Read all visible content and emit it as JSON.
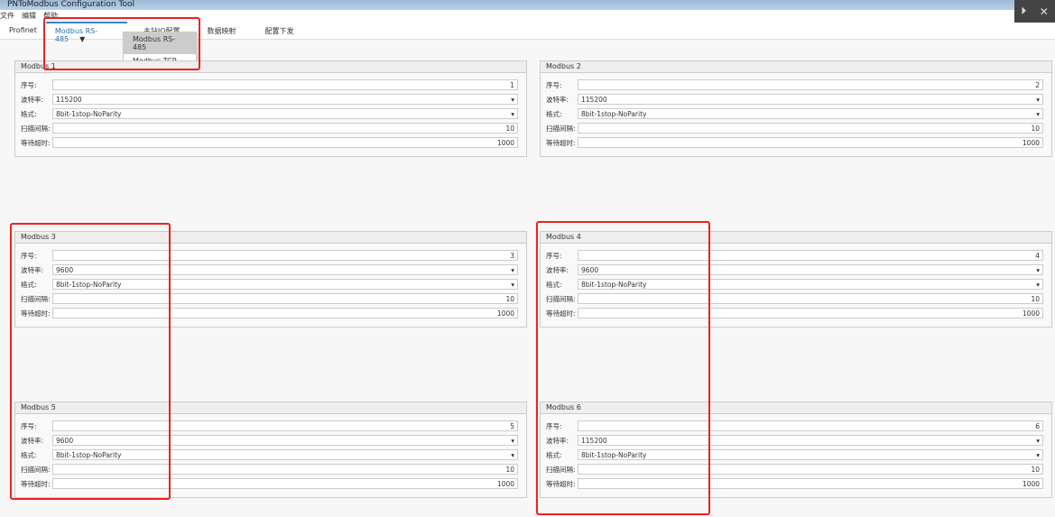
{
  "window": {
    "title": "PNToModbus Configuration Tool"
  },
  "menu": [
    "文件",
    "编辑",
    "帮助"
  ],
  "tabs": [
    "Profinet",
    "Modbus RS-485",
    "主站IO配置",
    "数据映射",
    "配置下发"
  ],
  "tab_dropdown": {
    "arrow": "▼",
    "options": [
      "Modbus RS-485",
      "Modbus TCP"
    ],
    "selected": "Modbus RS-485"
  },
  "labels": {
    "index": "序号:",
    "baud": "波特率:",
    "format": "格式:",
    "scan": "扫描间隔:",
    "timeout": "等待超时:"
  },
  "panels": [
    {
      "title": "Modbus 1",
      "index": "1",
      "baud": "115200",
      "format": "8bit-1stop-NoParity",
      "scan": "10",
      "timeout": "1000"
    },
    {
      "title": "Modbus 2",
      "index": "2",
      "baud": "115200",
      "format": "8bit-1stop-NoParity",
      "scan": "10",
      "timeout": "1000"
    },
    {
      "title": "Modbus 3",
      "index": "3",
      "baud": "9600",
      "format": "8bit-1stop-NoParity",
      "scan": "10",
      "timeout": "1000"
    },
    {
      "title": "Modbus 4",
      "index": "4",
      "baud": "9600",
      "format": "8bit-1stop-NoParity",
      "scan": "10",
      "timeout": "1000"
    },
    {
      "title": "Modbus 5",
      "index": "5",
      "baud": "9600",
      "format": "8bit-1stop-NoParity",
      "scan": "10",
      "timeout": "1000"
    },
    {
      "title": "Modbus 6",
      "index": "6",
      "baud": "115200",
      "format": "8bit-1stop-NoParity",
      "scan": "10",
      "timeout": "1000"
    }
  ],
  "annotation_color": "#f02020"
}
